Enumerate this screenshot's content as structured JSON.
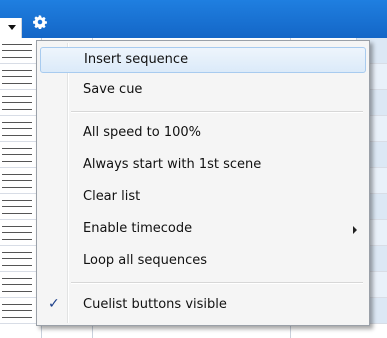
{
  "menu": {
    "items": [
      {
        "label": "Insert sequence",
        "highlighted": true
      },
      {
        "label": "Save cue"
      },
      {
        "label": "All speed to 100%"
      },
      {
        "label": "Always start with 1st scene"
      },
      {
        "label": "Clear list"
      },
      {
        "label": "Enable timecode",
        "has_submenu": true
      },
      {
        "label": "Loop all sequences"
      },
      {
        "label": "Cuelist buttons visible",
        "checked": true
      }
    ],
    "check_glyph": "✓"
  },
  "colors": {
    "titlebar": "#1a72d6",
    "highlight_border": "#a8cbef",
    "menu_bg": "#f5f5f5"
  },
  "icons": {
    "dropdown": "chevron-down-icon",
    "settings": "gear-icon",
    "submenu": "chevron-right-icon",
    "check": "check-icon"
  }
}
